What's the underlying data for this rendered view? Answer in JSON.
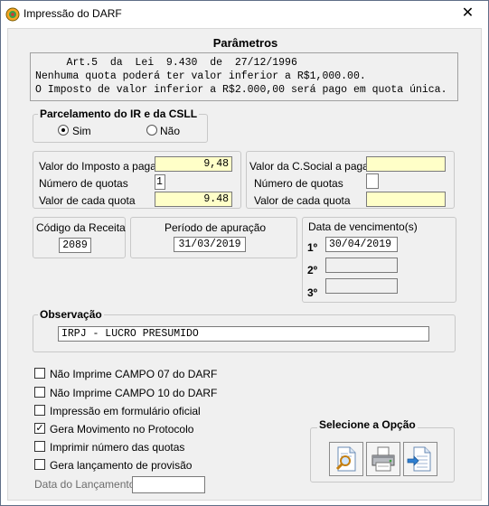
{
  "window": {
    "title": "Impressão do DARF",
    "close_label": "✕"
  },
  "parametros": {
    "title": "Parâmetros",
    "notice_lines": [
      "     Art.5  da  Lei  9.430  de  27/12/1996",
      "Nenhuma quota poderá ter valor inferior a R$1,000.00.",
      "O Imposto de valor inferior a R$2.000,00 será pago em quota única."
    ]
  },
  "parcelamento": {
    "title": "Parcelamento do IR e da CSLL",
    "options": [
      {
        "label": "Sim",
        "checked": true
      },
      {
        "label": "Não",
        "checked": false
      }
    ]
  },
  "imposto": {
    "valor_label": "Valor do Imposto a pagar",
    "valor": "9,48",
    "quotas_label": "Número de quotas",
    "quotas": "1",
    "cada_label": "Valor de cada quota",
    "cada": "9.48"
  },
  "csocial": {
    "valor_label": "Valor da C.Social a pagar",
    "valor": "",
    "quotas_label": "Número de quotas",
    "quotas": "",
    "cada_label": "Valor de cada quota",
    "cada": ""
  },
  "codigo_receita": {
    "label": "Código da Receita",
    "value": "2089"
  },
  "periodo": {
    "label": "Período de apuração",
    "value": "31/03/2019"
  },
  "vencimento": {
    "label": "Data de vencimento(s)",
    "items": [
      {
        "ord": "1º",
        "value": "30/04/2019"
      },
      {
        "ord": "2º",
        "value": ""
      },
      {
        "ord": "3º",
        "value": ""
      }
    ]
  },
  "observacao": {
    "title": "Observação",
    "value": "IRPJ - LUCRO PRESUMIDO"
  },
  "options": [
    {
      "label": "Não Imprime CAMPO 07 do DARF",
      "checked": false
    },
    {
      "label": "Não Imprime CAMPO 10 do DARF",
      "checked": false
    },
    {
      "label": "Impressão em formulário oficial",
      "checked": false
    },
    {
      "label": "Gera Movimento no Protocolo",
      "checked": true
    },
    {
      "label": "Imprimir número das quotas",
      "checked": false
    },
    {
      "label": "Gera lançamento de provisão",
      "checked": false
    }
  ],
  "data_lancamento": {
    "label": "Data do Lançamento:",
    "value": ""
  },
  "selecione": {
    "title": "Selecione a Opção",
    "buttons": [
      {
        "icon": "preview-icon"
      },
      {
        "icon": "printer-icon"
      },
      {
        "icon": "export-document-icon"
      }
    ]
  },
  "colors": {
    "field_yellow": "#ffffc8",
    "background": "#f0f0f0"
  }
}
